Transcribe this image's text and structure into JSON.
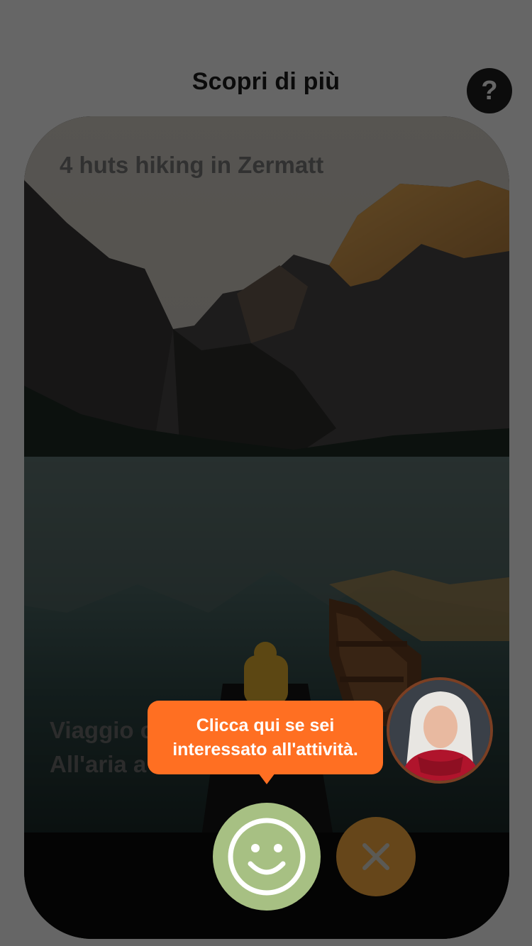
{
  "header": {
    "title": "Scopri di più",
    "help_label": "?"
  },
  "card": {
    "title": "4 huts hiking in Zermatt",
    "tags": [
      "Viaggio c",
      "All'aria a"
    ]
  },
  "tooltip": {
    "text_line1": "Clicca qui se sei",
    "text_line2": "interessato all'attività."
  },
  "actions": {
    "like_icon": "smiley-icon",
    "dislike_icon": "close-icon"
  },
  "colors": {
    "accent": "#ff6f22",
    "like": "#a7c083",
    "dislike": "#66461a"
  }
}
